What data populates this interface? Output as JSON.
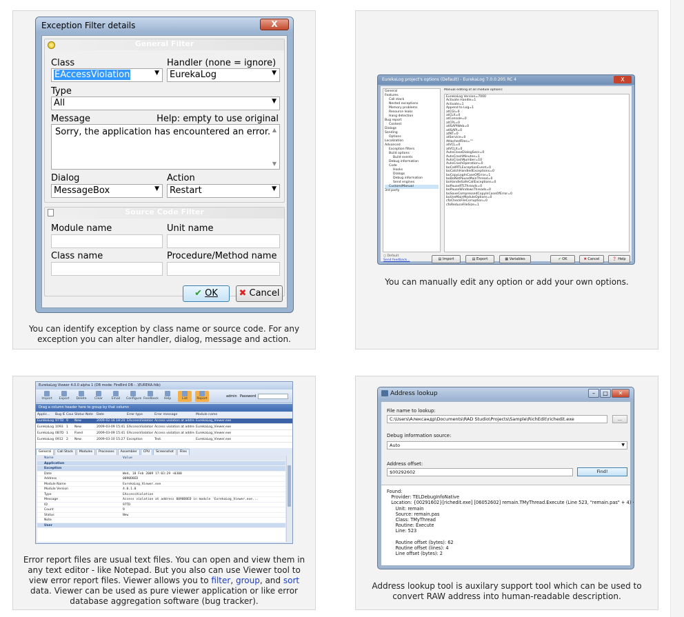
{
  "captions": {
    "exception_filter": "You can identify exception by class name or source code. For any exception you can alter handler, dialog, message and action.",
    "manual_options": "You can manually edit any option or add your own options.",
    "viewer_pre": "Error report files are usual text files. You can open and view them in any text editor - like Notepad. But you also can use Viewer tool to view error report files. Viewer allows you to ",
    "viewer_link_filter": "filter",
    "viewer_sep1": ", ",
    "viewer_link_group": "group",
    "viewer_sep2": ", and ",
    "viewer_link_sort": "sort",
    "viewer_post": " data. Viewer can be used as pure viewer application or like error database aggregation software (bug tracker).",
    "address_lookup": "Address lookup tool is auxilary support tool which can be used to convert RAW address into human-readable description."
  },
  "exception_filter": {
    "title": "Exception Filter details",
    "close": "X",
    "general_group": "General Filter",
    "class_label": "Class",
    "class_value": "EAccessViolation",
    "handler_label": "Handler (none = ignore)",
    "handler_value": "EurekaLog",
    "type_label": "Type",
    "type_value": "All",
    "message_label": "Message",
    "message_help": "Help: empty to use original",
    "message_value": "Sorry, the application has encountered an error.",
    "dialog_label": "Dialog",
    "dialog_value": "MessageBox",
    "action_label": "Action",
    "action_value": "Restart",
    "source_group": "Source Code Filter",
    "module_label": "Module name",
    "unit_label": "Unit name",
    "classname_label": "Class name",
    "procedure_label": "Procedure/Method name",
    "ok": "OK",
    "cancel": "Cancel"
  },
  "project_options": {
    "title": "EurekaLog project's options (Default) - EurekaLog 7.0.0.205 RC 4",
    "close": "X",
    "tree": [
      "General",
      "Features",
      "Call stack",
      "Nested exceptions",
      "Memory problems",
      "Resource leaks",
      "Hang detection",
      "Bug report",
      "Content",
      "Dialogs",
      "Sending",
      "Options",
      "Localization",
      "Advanced",
      "Exception filters",
      "Build options",
      "Build events",
      "Debug information",
      "Code",
      "Hooks",
      "Dialogs",
      "Debug information",
      "Send engines",
      "Custom/Manual",
      "3rd party"
    ],
    "tree_indent": [
      0,
      0,
      1,
      1,
      1,
      1,
      1,
      0,
      1,
      0,
      0,
      1,
      0,
      0,
      1,
      1,
      2,
      1,
      1,
      2,
      2,
      2,
      2,
      1,
      0
    ],
    "options_label": "Manual editing of all module options:",
    "options": [
      "EurekaLog Version=7000",
      "Activate Handle=1",
      "Activate=1",
      "Append to Log=1",
      "atCGI=0",
      "atCLX=0",
      "atConsole=0",
      "atCPL=0",
      "atISAPIWeb=0",
      "atISAPI=0",
      "atNT=0",
      "atService=0",
      "AttachedFiles=\"\"",
      "atVCL=0",
      "atVCLX=0",
      "AutoCloseDialogSecs=0",
      "AutoCrashMinutes=1",
      "AutoCrashNumber=10",
      "AutoCrashOperation=0",
      "boCallRTLExceptionEvent=0",
      "boCatchHandledExceptions=0",
      "boCopyLogInCaseOfError=1",
      "boDoNotPauseMainThread=0",
      "boHandleSafeCallExceptions=0",
      "boPauseRTLThreads=0",
      "boPauseWindowsThreads=0",
      "boSaveCompressedCopyInCaseOfError=0",
      "boUseMainModuleOptions=0",
      "cfoCheckFileCorruption=0",
      "cfoReduceFileSize=1"
    ],
    "default_label": "Default",
    "feedback_link": "Send feedback...",
    "import": "Import",
    "export": "Export",
    "variables": "Variables",
    "ok": "OK",
    "cancel": "Cancel",
    "help": "Help"
  },
  "viewer": {
    "title": "EurekaLog Viewer 4.0.0 alpha 1 (DB mode: FireBird DB - .\\EUREKA.fdb)",
    "tools": [
      "Import",
      "Export",
      "Delete",
      "Clear",
      "Email",
      "Configure",
      "Feedback",
      "Help",
      "List",
      "Report"
    ],
    "user_label": "admin",
    "password_label": "Password",
    "group_hint": "Drag a column header here to group by that column",
    "columns": [
      "Applic...",
      "Bug ID",
      "Count",
      "Status",
      "Note",
      "Date",
      "Error type",
      "Error message",
      "Module name"
    ],
    "rows": [
      [
        "EurekaLog",
        "97TD",
        "9",
        "New",
        "",
        "2009-02-16 18:20:29",
        "EAccessViolation",
        "Access violation at address 009...",
        "EurekaLog_Viewer.exe"
      ],
      [
        "EurekaLog",
        "1093",
        "1",
        "New",
        "",
        "2009-03-09 15:41:32",
        "EAccessViolation",
        "Access violation at address 004...",
        "EurekaLog_Viewer.exe"
      ],
      [
        "EurekaLog",
        "0B7D",
        "1",
        "Fixed",
        "",
        "2009-03-09 15:41:57",
        "EAccessViolation",
        "Access violation at address 004...",
        "EurekaLog_Viewer.exe"
      ],
      [
        "EurekaLog",
        "0912",
        "2",
        "New",
        "",
        "2009-03-10 15:27:26",
        "Exception",
        "Test.",
        "EurekaLog_Viewer.exe"
      ]
    ],
    "tabs": [
      "General",
      "Call Stack",
      "Modules",
      "Processes",
      "Assembler",
      "CPU",
      "Screenshot",
      "Files"
    ],
    "prop_head_name": "Name",
    "prop_head_value": "Value",
    "sections": [
      "Application",
      "Exception",
      "User"
    ],
    "props": [
      [
        "Date",
        "Wed, 18 Feb 2009 17:03:29 +0300"
      ],
      [
        "Address",
        "0090D8ED"
      ],
      [
        "Module Name",
        "EurekaLog_Viewer.exe"
      ],
      [
        "Module Version",
        "4.0.1.0"
      ],
      [
        "Type",
        "EAccessViolation"
      ],
      [
        "Message",
        "Access violation at address 0090D8ED in module 'EurekaLog_Viewer.exe..."
      ],
      [
        "ID",
        "97TD"
      ],
      [
        "Count",
        "9"
      ],
      [
        "Status",
        "New"
      ],
      [
        "Note",
        ""
      ]
    ]
  },
  "address_lookup": {
    "title": "Address lookup",
    "file_label": "File name to lookup:",
    "file_value": "C:\\Users\\Александр\\Documents\\RAD Studio\\Projects\\Sample\\RichEdit\\richedit.exe",
    "browse": "...",
    "debug_label": "Debug information source:",
    "debug_value": "Auto",
    "offset_label": "Address offset:",
    "offset_value": "$00292602",
    "find": "Find!",
    "result": "Found:\n   Provider: TELDebugInfoNative\n   Location: {00291602}[richedit.exe] [06052602] remain.TMyThread.Execute (Line 523, \"remain.pas\" + 4) + $2\n      Unit: remain\n      Source: remain.pas\n      Class: TMyThread\n      Routine: Execute\n      Line: 523\n\n      Routine offset (bytes): 62\n      Routine offset (lines): 4\n      Line offset (bytes): 2"
  }
}
